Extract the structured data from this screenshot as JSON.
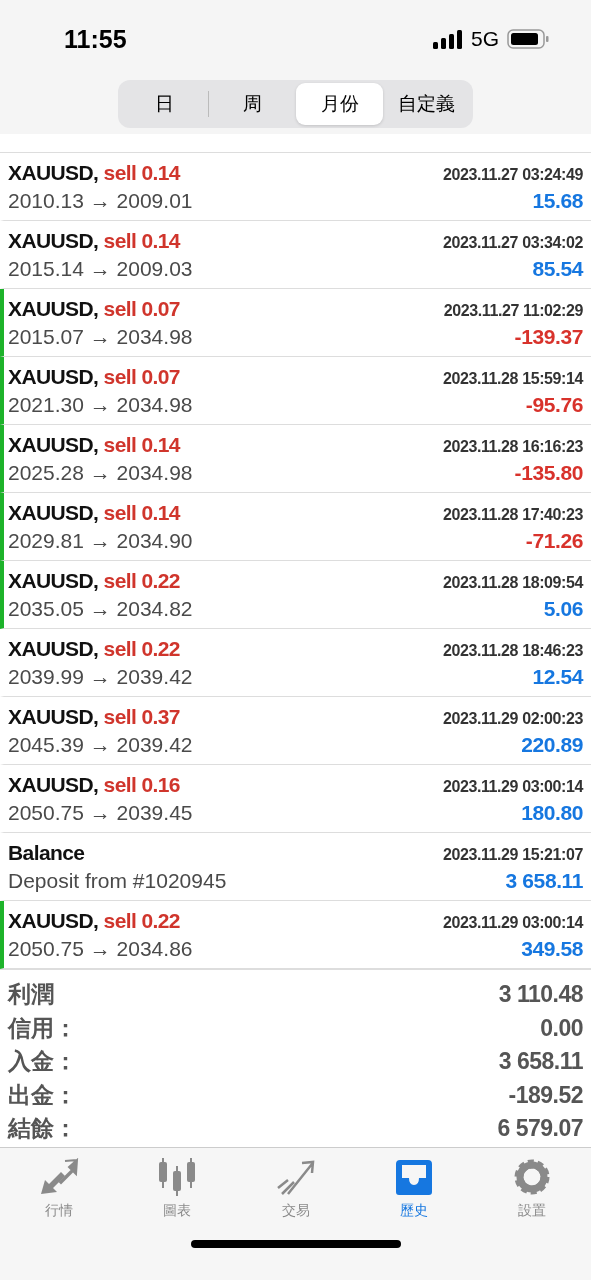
{
  "status_bar": {
    "time": "11:55",
    "network": "5G"
  },
  "segments": [
    {
      "label": "日",
      "selected": false
    },
    {
      "label": "周",
      "selected": false
    },
    {
      "label": "月份",
      "selected": true
    },
    {
      "label": "自定義",
      "selected": false
    }
  ],
  "deals": [
    {
      "kind": "trade",
      "symbol": "XAUUSD,",
      "side": "sell 0.14",
      "time": "2023.11.27 03:24:49",
      "prices": "2010.13 → 2009.01",
      "profit": "15.68",
      "loss": false,
      "marked": false
    },
    {
      "kind": "trade",
      "symbol": "XAUUSD,",
      "side": "sell 0.14",
      "time": "2023.11.27 03:34:02",
      "prices": "2015.14 → 2009.03",
      "profit": "85.54",
      "loss": false,
      "marked": false
    },
    {
      "kind": "trade",
      "symbol": "XAUUSD,",
      "side": "sell 0.07",
      "time": "2023.11.27 11:02:29",
      "prices": "2015.07 → 2034.98",
      "profit": "-139.37",
      "loss": true,
      "marked": true
    },
    {
      "kind": "trade",
      "symbol": "XAUUSD,",
      "side": "sell 0.07",
      "time": "2023.11.28 15:59:14",
      "prices": "2021.30 → 2034.98",
      "profit": "-95.76",
      "loss": true,
      "marked": true
    },
    {
      "kind": "trade",
      "symbol": "XAUUSD,",
      "side": "sell 0.14",
      "time": "2023.11.28 16:16:23",
      "prices": "2025.28 → 2034.98",
      "profit": "-135.80",
      "loss": true,
      "marked": true
    },
    {
      "kind": "trade",
      "symbol": "XAUUSD,",
      "side": "sell 0.14",
      "time": "2023.11.28 17:40:23",
      "prices": "2029.81 → 2034.90",
      "profit": "-71.26",
      "loss": true,
      "marked": true
    },
    {
      "kind": "trade",
      "symbol": "XAUUSD,",
      "side": "sell 0.22",
      "time": "2023.11.28 18:09:54",
      "prices": "2035.05 → 2034.82",
      "profit": "5.06",
      "loss": false,
      "marked": true
    },
    {
      "kind": "trade",
      "symbol": "XAUUSD,",
      "side": "sell 0.22",
      "time": "2023.11.28 18:46:23",
      "prices": "2039.99 → 2039.42",
      "profit": "12.54",
      "loss": false,
      "marked": false
    },
    {
      "kind": "trade",
      "symbol": "XAUUSD,",
      "side": "sell 0.37",
      "time": "2023.11.29 02:00:23",
      "prices": "2045.39 → 2039.42",
      "profit": "220.89",
      "loss": false,
      "marked": false
    },
    {
      "kind": "trade",
      "symbol": "XAUUSD,",
      "side": "sell 0.16",
      "time": "2023.11.29 03:00:14",
      "prices": "2050.75 → 2039.45",
      "profit": "180.80",
      "loss": false,
      "marked": false
    },
    {
      "kind": "balance",
      "symbol": "Balance",
      "time": "2023.11.29 15:21:07",
      "prices": "Deposit from #1020945",
      "profit": "3 658.11",
      "loss": false,
      "marked": false
    },
    {
      "kind": "trade",
      "symbol": "XAUUSD,",
      "side": "sell 0.22",
      "time": "2023.11.29 03:00:14",
      "prices": "2050.75 → 2034.86",
      "profit": "349.58",
      "loss": false,
      "marked": true
    }
  ],
  "summary": [
    {
      "label": "利潤",
      "value": "3 110.48"
    },
    {
      "label": "信用：",
      "value": "0.00"
    },
    {
      "label": "入金：",
      "value": "3 658.11"
    },
    {
      "label": "出金：",
      "value": "-189.52"
    },
    {
      "label": "結餘：",
      "value": "6 579.07"
    }
  ],
  "tab_bar": [
    {
      "kind": "quotes",
      "label": "行情",
      "selected": false
    },
    {
      "kind": "chart",
      "label": "圖表",
      "selected": false
    },
    {
      "kind": "trade",
      "label": "交易",
      "selected": false
    },
    {
      "kind": "history",
      "label": "歷史",
      "selected": true
    },
    {
      "kind": "settings",
      "label": "設置",
      "selected": false
    }
  ]
}
